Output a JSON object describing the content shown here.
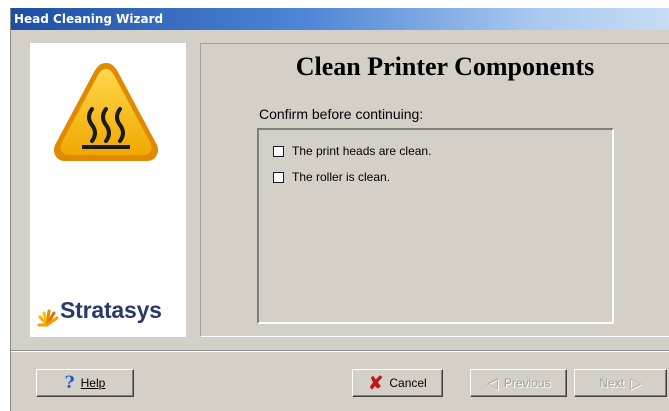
{
  "window": {
    "title": "Head Cleaning Wizard",
    "title_bar_color": "#1c4fa3"
  },
  "side_panel": {
    "icon": "hot-surface-warning-icon",
    "logo_text": "Stratasys",
    "logo_icon": "stratasys-starburst-icon"
  },
  "main": {
    "heading": "Clean Printer Components",
    "prompt": "Confirm before continuing:",
    "checks": [
      {
        "label": "The print heads are clean.",
        "checked": false
      },
      {
        "label": "The roller is clean.",
        "checked": false
      }
    ]
  },
  "buttons": {
    "help": {
      "label": "Help",
      "icon": "help-question-icon",
      "enabled": true
    },
    "cancel": {
      "label": "Cancel",
      "icon": "cancel-x-icon",
      "enabled": true
    },
    "previous": {
      "label": "Previous",
      "icon": "arrow-left-icon",
      "enabled": false
    },
    "next": {
      "label": "Next",
      "icon": "arrow-right-icon",
      "enabled": false
    }
  }
}
